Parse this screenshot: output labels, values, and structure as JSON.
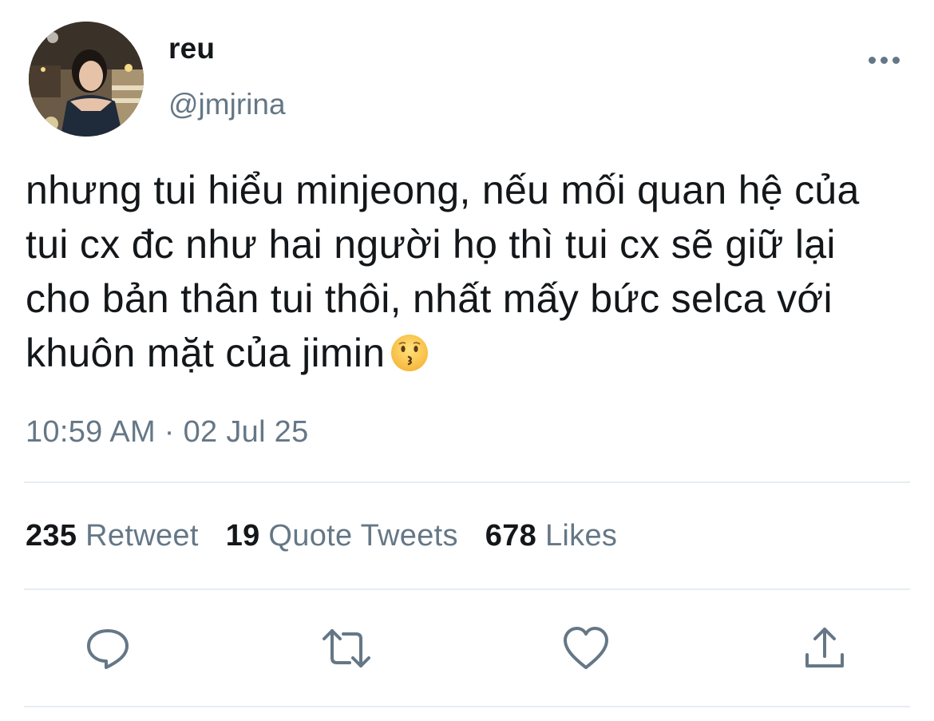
{
  "user": {
    "display_name": "reu",
    "handle": "@jmjrina"
  },
  "menu": {
    "more_icon": "more-horizontal-icon"
  },
  "tweet": {
    "text": "nhưng tui hiểu minjeong, nếu mối quan hệ của tui cx đc như hai người họ thì tui cx sẽ giữ lại cho bản thân tui thôi, nhất mấy bức selca với khuôn mặt của jimin",
    "emoji": "kissing-face-emoji",
    "timestamp": "10:59 AM · 02 Jul 25"
  },
  "stats": {
    "retweets_count": "235",
    "retweets_label": "Retweet",
    "quotes_count": "19",
    "quotes_label": "Quote Tweets",
    "likes_count": "678",
    "likes_label": "Likes"
  },
  "actions": [
    {
      "icon": "reply-icon"
    },
    {
      "icon": "retweet-icon"
    },
    {
      "icon": "like-heart-icon"
    },
    {
      "icon": "share-icon"
    }
  ],
  "colors": {
    "text_primary": "#14171a",
    "text_secondary": "#657786",
    "divider": "#e6ecf0"
  }
}
